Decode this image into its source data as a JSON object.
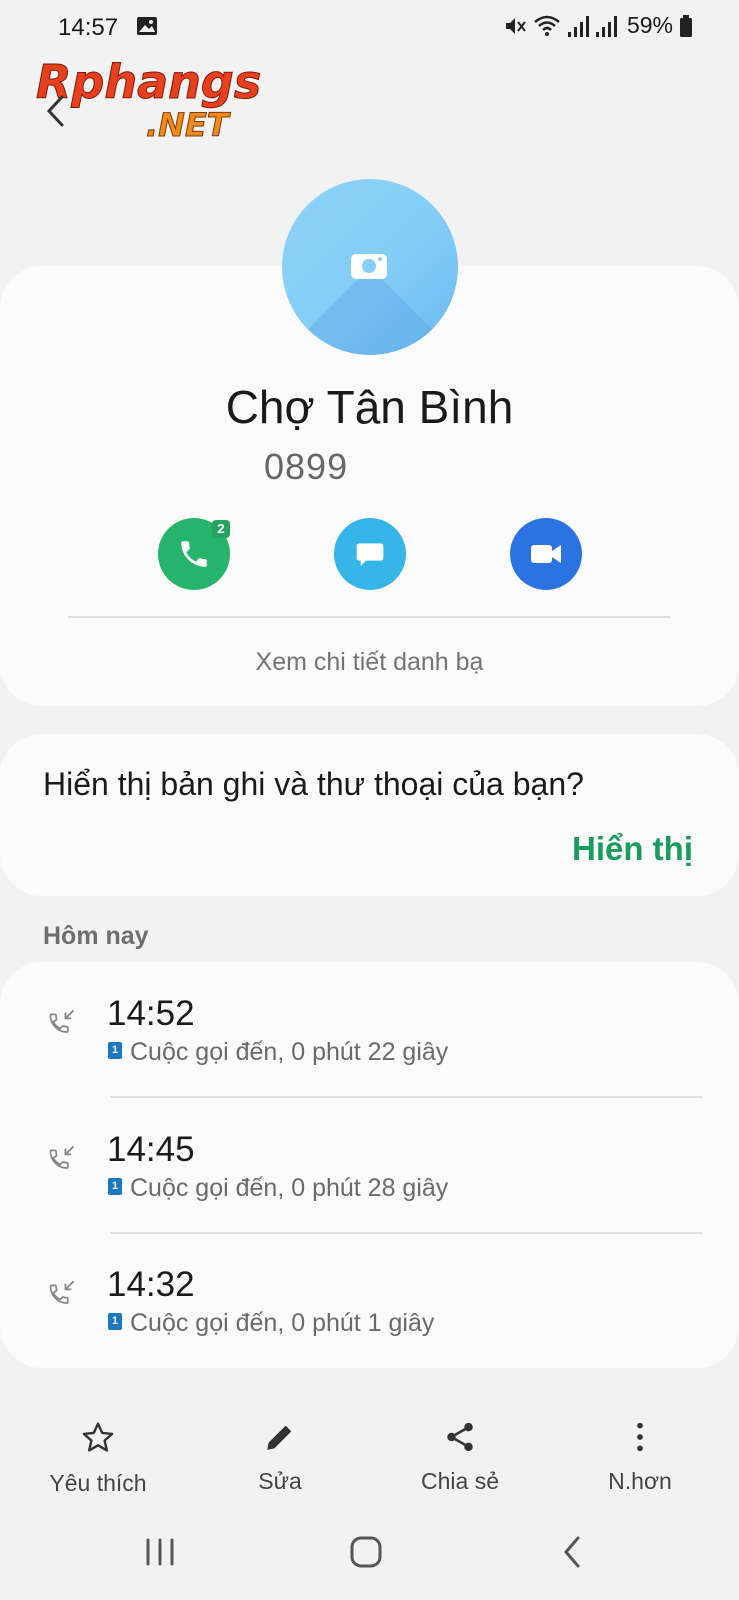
{
  "status_bar": {
    "time": "14:57",
    "battery": "59%",
    "icons": [
      "gallery-icon",
      "mute-icon",
      "wifi-icon",
      "signal-icon",
      "signal-icon",
      "battery-icon"
    ]
  },
  "watermark": {
    "line1": "Rphangs",
    "line2": ".NET"
  },
  "contact": {
    "name": "Chợ Tân Bình",
    "number_visible": "0899",
    "call_badge": "2",
    "view_details": "Xem chi tiết danh bạ"
  },
  "voicemail_prompt": {
    "question": "Hiển thị bản ghi và thư thoại của bạn?",
    "action": "Hiển thị"
  },
  "call_log": {
    "section": "Hôm nay",
    "entries": [
      {
        "time": "14:52",
        "sim": "1",
        "description": "Cuộc gọi đến, 0 phút 22 giây"
      },
      {
        "time": "14:45",
        "sim": "1",
        "description": "Cuộc gọi đến, 0 phút 28 giây"
      },
      {
        "time": "14:32",
        "sim": "1",
        "description": "Cuộc gọi đến, 0 phút 1 giây"
      }
    ]
  },
  "toolbar": {
    "favorite": "Yêu thích",
    "edit": "Sửa",
    "share": "Chia sẻ",
    "more": "N.hơn"
  },
  "colors": {
    "call_green": "#26b36b",
    "message_blue": "#35b6e8",
    "video_blue": "#2b73e0",
    "accent_green": "#1a9c5e",
    "avatar_blue": "#83cdf6"
  }
}
